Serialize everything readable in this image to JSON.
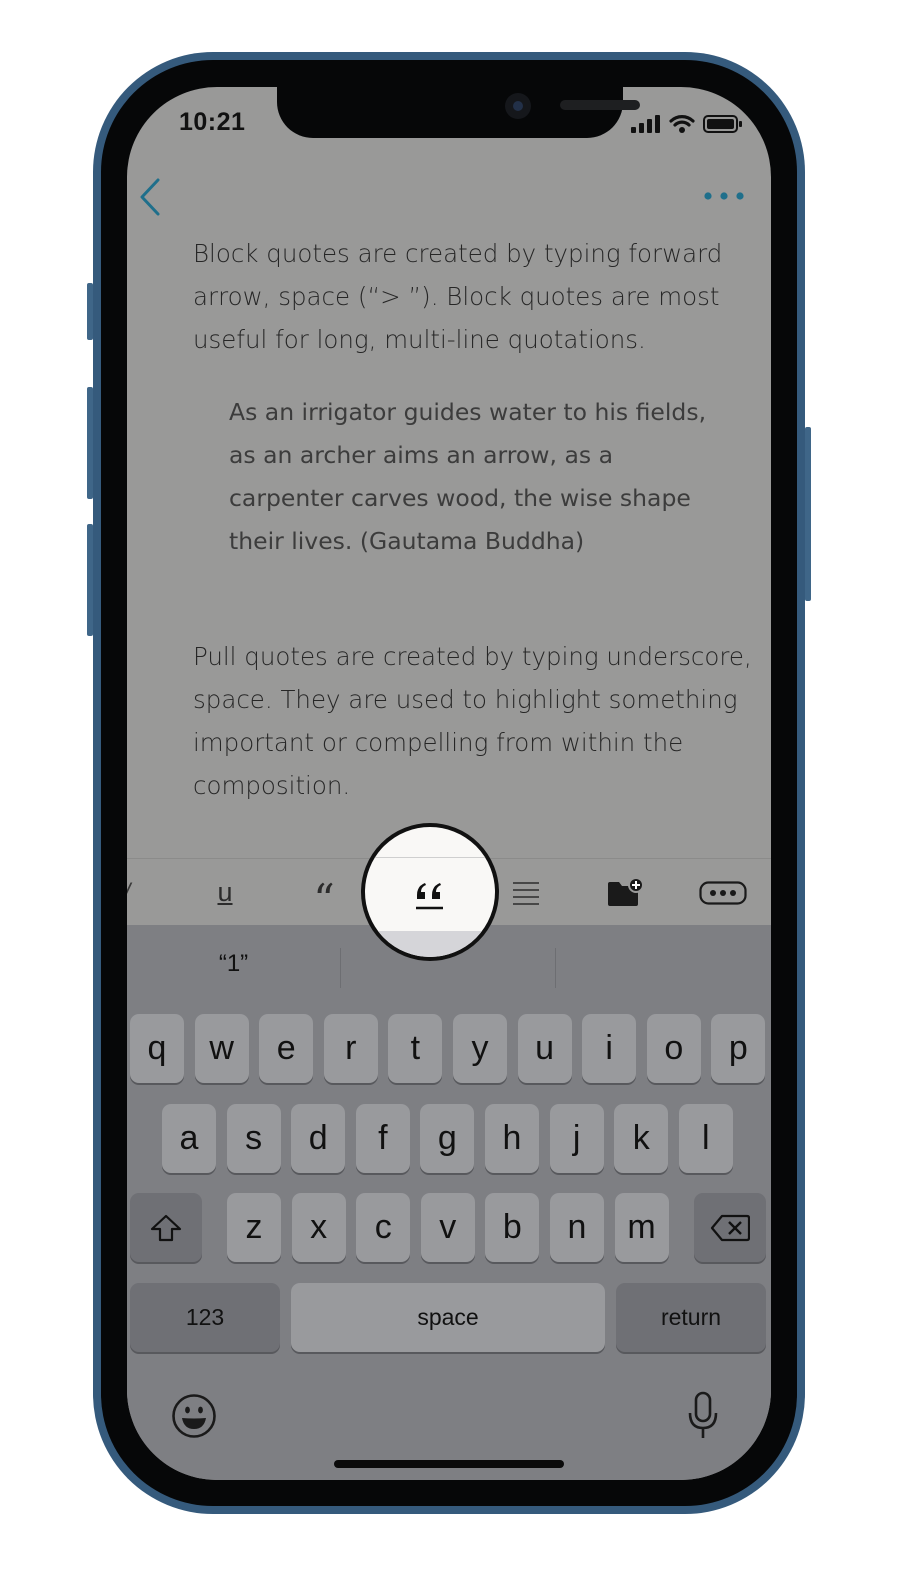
{
  "status_bar": {
    "time": "10:21"
  },
  "document": {
    "paragraph_1": "Block quotes are created by typing forward arrow, space (“> ”). Block quotes are most useful for long, multi-line quotations.",
    "block_quote": "As an irrigator guides water to his fields, as an archer aims an arrow, as a carpenter carves wood, the wise shape their lives. (Gautama Buddha)",
    "paragraph_2": "Pull quotes are created by typing underscore, space. They are used to highlight something important or compelling from within the composition."
  },
  "toolbar": {
    "items": [
      "underline",
      "quote",
      "pull-quote",
      "list",
      "folder-add",
      "more"
    ],
    "underline_label": "u",
    "quote_label": "“",
    "magnified_item": "pull-quote"
  },
  "keyboard": {
    "suggestions": [
      "“1”",
      "",
      ""
    ],
    "row1": [
      "q",
      "w",
      "e",
      "r",
      "t",
      "y",
      "u",
      "i",
      "o",
      "p"
    ],
    "row2": [
      "a",
      "s",
      "d",
      "f",
      "g",
      "h",
      "j",
      "k",
      "l"
    ],
    "row3": [
      "z",
      "x",
      "c",
      "v",
      "b",
      "n",
      "m"
    ],
    "numbers_label": "123",
    "space_label": "space",
    "return_label": "return"
  },
  "colors": {
    "accent": "#1f6f8b",
    "background": "#999998",
    "keyboard": "#7e7f83"
  }
}
